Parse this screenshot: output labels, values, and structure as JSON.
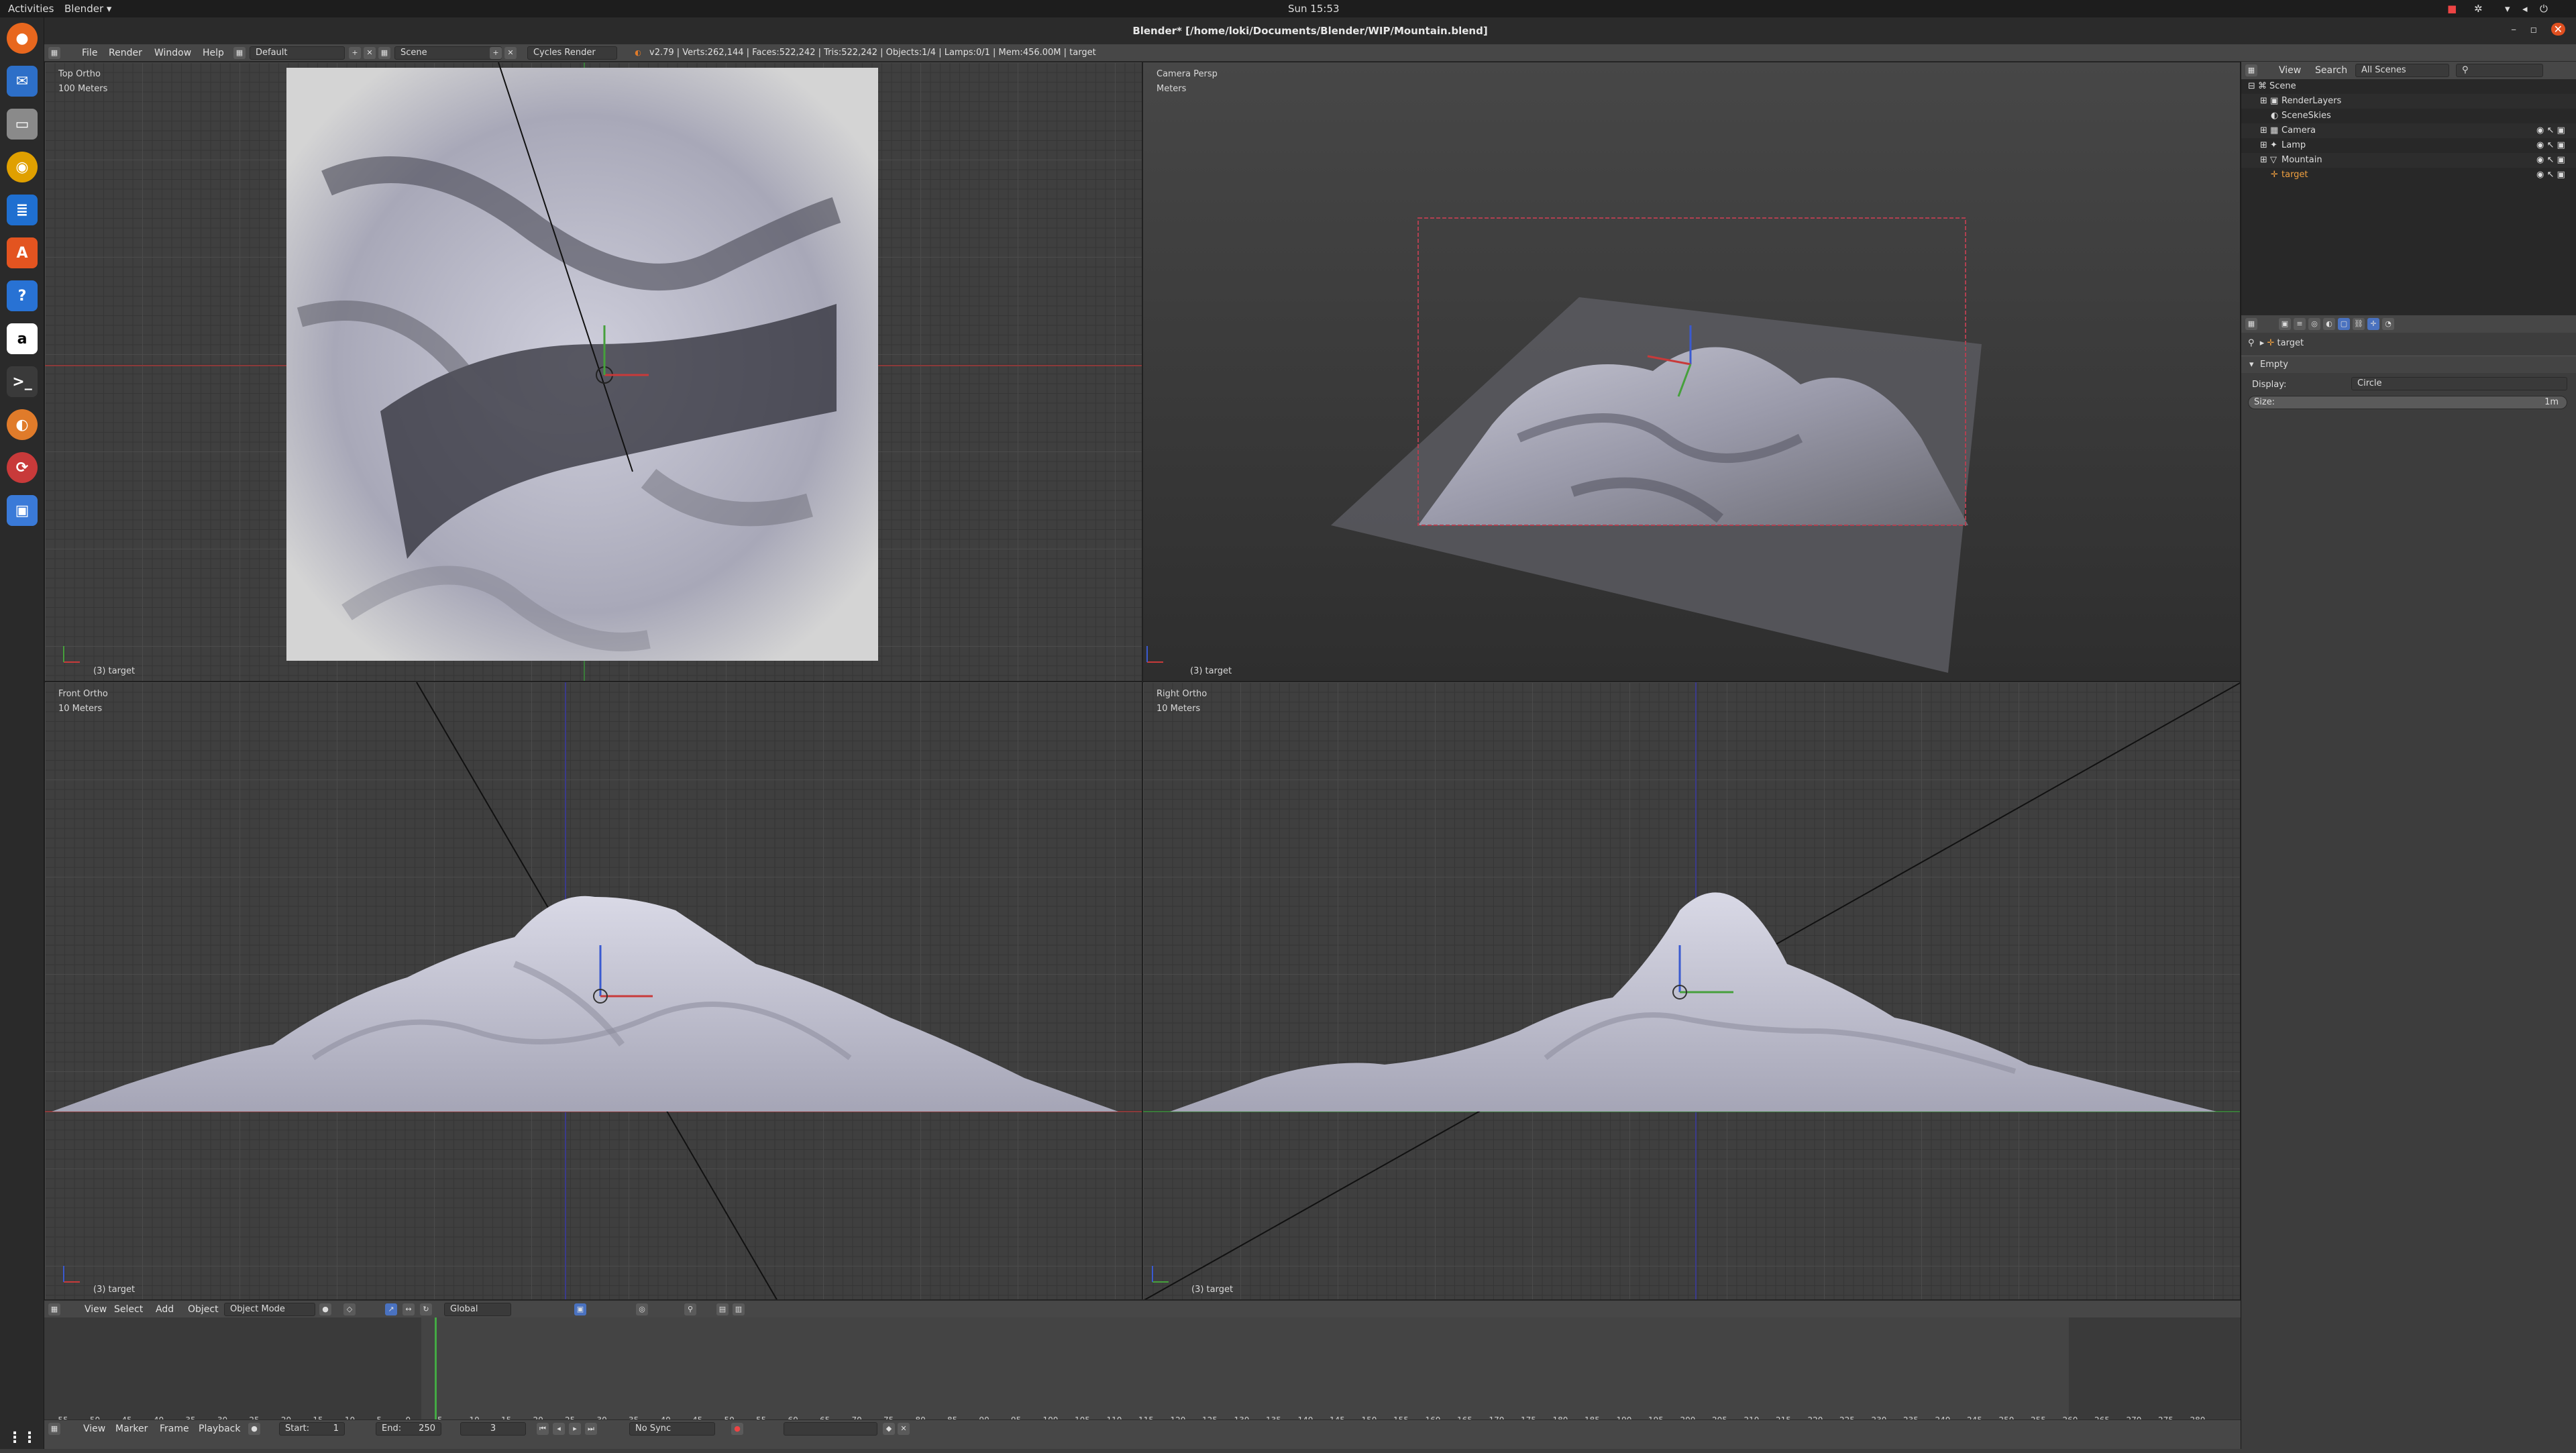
{
  "topbar": {
    "activities": "Activities",
    "app_menu": "Blender ▾",
    "clock": "Sun 15:53"
  },
  "window": {
    "title": "Blender* [/home/loki/Documents/Blender/WIP/Mountain.blend]"
  },
  "info_header": {
    "menus": [
      "File",
      "Render",
      "Window",
      "Help"
    ],
    "layout": "Default",
    "scene": "Scene",
    "engine": "Cycles Render",
    "stats": "v2.79 | Verts:262,144 | Faces:522,242 | Tris:522,242 | Objects:1/4 | Lamps:0/1 | Mem:456.00M | target"
  },
  "viewports": {
    "top": {
      "label": "Top Ortho",
      "scale": "100 Meters",
      "footer": "(3) target"
    },
    "camera": {
      "label": "Camera Persp",
      "scale": "Meters",
      "footer": "(3) target"
    },
    "front": {
      "label": "Front Ortho",
      "scale": "10 Meters",
      "footer": "(3) target"
    },
    "right": {
      "label": "Right Ortho",
      "scale": "10 Meters",
      "footer": "(3) target"
    }
  },
  "view3d_header": {
    "menus": [
      "View",
      "Select",
      "Add",
      "Object"
    ],
    "mode": "Object Mode",
    "orientation": "Global"
  },
  "timeline": {
    "ticks": [
      "-55",
      "-50",
      "-45",
      "-40",
      "-35",
      "-30",
      "-25",
      "-20",
      "-15",
      "-10",
      "-5",
      "0",
      "5",
      "10",
      "15",
      "20",
      "25",
      "30",
      "35",
      "40",
      "45",
      "50",
      "55",
      "60",
      "65",
      "70",
      "75",
      "80",
      "85",
      "90",
      "95",
      "100",
      "105",
      "110",
      "115",
      "120",
      "125",
      "130",
      "135",
      "140",
      "145",
      "150",
      "155",
      "160",
      "165",
      "170",
      "175",
      "180",
      "185",
      "190",
      "195",
      "200",
      "205",
      "210",
      "215",
      "220",
      "225",
      "230",
      "235",
      "240",
      "245",
      "250",
      "255",
      "260",
      "265",
      "270",
      "275",
      "280"
    ],
    "menus": [
      "View",
      "Marker",
      "Frame",
      "Playback"
    ],
    "start_label": "Start:",
    "start": "1",
    "end_label": "End:",
    "end": "250",
    "current": "3",
    "sync": "No Sync"
  },
  "outliner": {
    "menus": [
      "View",
      "Search"
    ],
    "scenes": "All Scenes",
    "items": [
      "Scene",
      "RenderLayers",
      "SceneSkies",
      "Camera",
      "Lamp",
      "Mountain",
      "target"
    ]
  },
  "properties": {
    "object": "target",
    "panel": "Empty",
    "display_label": "Display:",
    "display_value": "Circle",
    "size_label": "Size:",
    "size_value": "1m"
  },
  "colors": {
    "accent": "#e07b2a",
    "selected": "#f0a040",
    "axis_x": "#c83a3a",
    "axis_y": "#46a03c",
    "axis_z": "#3a5ad0"
  }
}
